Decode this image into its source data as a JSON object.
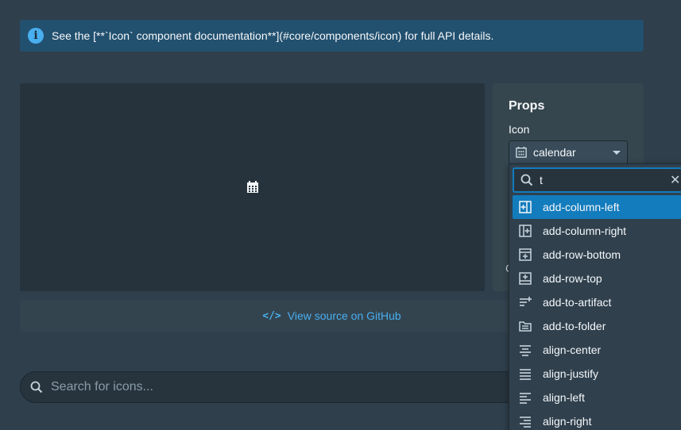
{
  "callout": {
    "text": "See the [**`Icon` component documentation**](#core/components/icon) for full API details.",
    "icon": "info-icon"
  },
  "props": {
    "title": "Props",
    "icon_label": "Icon",
    "selected_icon": "calendar",
    "partial_label": "C"
  },
  "source_link": {
    "label": "View source on GitHub",
    "icon": "code-icon"
  },
  "icon_search": {
    "placeholder": "Search for icons...",
    "value": ""
  },
  "dropdown": {
    "filter_value": "t",
    "items": [
      {
        "label": "add-column-left",
        "icon": "add-column-left-icon",
        "active": true
      },
      {
        "label": "add-column-right",
        "icon": "add-column-right-icon",
        "active": false
      },
      {
        "label": "add-row-bottom",
        "icon": "add-row-bottom-icon",
        "active": false
      },
      {
        "label": "add-row-top",
        "icon": "add-row-top-icon",
        "active": false
      },
      {
        "label": "add-to-artifact",
        "icon": "add-to-artifact-icon",
        "active": false
      },
      {
        "label": "add-to-folder",
        "icon": "add-to-folder-icon",
        "active": false
      },
      {
        "label": "align-center",
        "icon": "align-center-icon",
        "active": false
      },
      {
        "label": "align-justify",
        "icon": "align-justify-icon",
        "active": false
      },
      {
        "label": "align-left",
        "icon": "align-left-icon",
        "active": false
      },
      {
        "label": "align-right",
        "icon": "align-right-icon",
        "active": false
      }
    ]
  },
  "colors": {
    "background": "#2f3f4c",
    "accent": "#137cbd",
    "link": "#48aff0"
  }
}
